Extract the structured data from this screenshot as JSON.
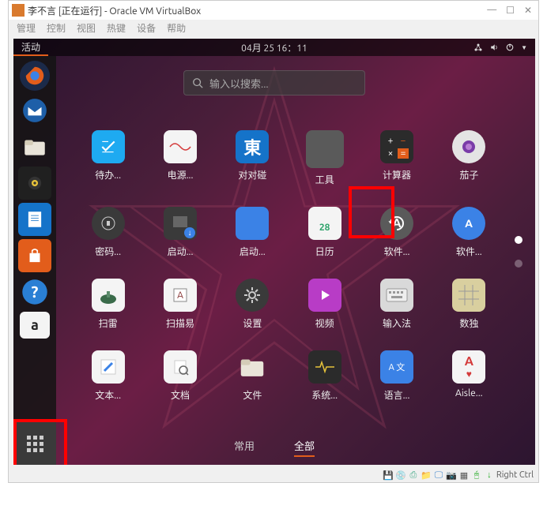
{
  "window": {
    "title": "李不言 [正在运行] - Oracle VM VirtualBox"
  },
  "menu": {
    "items": [
      "管理",
      "控制",
      "视图",
      "热键",
      "设备",
      "帮助"
    ]
  },
  "top_panel": {
    "activities": "活动",
    "clock": "04月 25 16：11"
  },
  "search": {
    "placeholder": "输入以搜索..."
  },
  "dock": {
    "items": [
      {
        "name": "firefox",
        "bg": "#1b2a49"
      },
      {
        "name": "thunderbird",
        "bg": "#1b2a49"
      },
      {
        "name": "files",
        "bg": "#e9e4d9"
      },
      {
        "name": "rhythmbox",
        "bg": "#202020"
      },
      {
        "name": "libreoffice-writer",
        "bg": "#1573c9"
      },
      {
        "name": "software",
        "bg": "#e25d1b"
      },
      {
        "name": "help",
        "bg": "#2a7fd4"
      },
      {
        "name": "amazon",
        "bg": "#f4f4f4"
      }
    ]
  },
  "apps": [
    {
      "label": "待办...",
      "bg": "#1eaaf1",
      "name": "todo"
    },
    {
      "label": "电源...",
      "bg": "#f4f4f4",
      "name": "power-stats"
    },
    {
      "label": "对对碰",
      "bg": "#1573c9",
      "name": "mahjongg"
    },
    {
      "label": "工具",
      "bg": "#5a5a5a",
      "name": "utilities-folder"
    },
    {
      "label": "计算器",
      "bg": "#2b2b2b",
      "name": "calculator"
    },
    {
      "label": "茄子",
      "bg": "#e4e4e4",
      "name": "cheese"
    },
    {
      "label": "密码...",
      "bg": "#3a3a3a",
      "name": "passwords"
    },
    {
      "label": "启动...",
      "bg": "#3a3a3a",
      "name": "startup-disk"
    },
    {
      "label": "启动...",
      "bg": "#3b82e6",
      "name": "startup-apps"
    },
    {
      "label": "日历",
      "bg": "#2fa36b",
      "name": "calendar",
      "text": "28"
    },
    {
      "label": "软件...",
      "bg": "#5a5a5a",
      "name": "software-updater"
    },
    {
      "label": "软件...",
      "bg": "#3b82e6",
      "name": "software-center"
    },
    {
      "label": "扫雷",
      "bg": "#f4f4f4",
      "name": "mines"
    },
    {
      "label": "扫描易",
      "bg": "#f4f4f4",
      "name": "simple-scan"
    },
    {
      "label": "设置",
      "bg": "#3a3a3a",
      "name": "settings"
    },
    {
      "label": "视频",
      "bg": "#b83cc6",
      "name": "videos"
    },
    {
      "label": "输入法",
      "bg": "#d9d9d9",
      "name": "input-method"
    },
    {
      "label": "数独",
      "bg": "#d9cf9f",
      "name": "sudoku"
    },
    {
      "label": "文本...",
      "bg": "#f4f4f4",
      "name": "text-editor"
    },
    {
      "label": "文档",
      "bg": "#f4f4f4",
      "name": "documents"
    },
    {
      "label": "文件",
      "bg": "#f4f4f4",
      "name": "files"
    },
    {
      "label": "系统...",
      "bg": "#2b2b2b",
      "name": "system-monitor"
    },
    {
      "label": "语言...",
      "bg": "#3b82e6",
      "name": "language"
    },
    {
      "label": "Aisle...",
      "bg": "#f4f4f4",
      "name": "aisleriot"
    }
  ],
  "tabs": {
    "frequent": "常用",
    "all": "全部"
  },
  "status_bar": {
    "host_key": "Right Ctrl"
  },
  "colors": {
    "highlight": "#ff0000",
    "accent": "#e25d1b"
  }
}
